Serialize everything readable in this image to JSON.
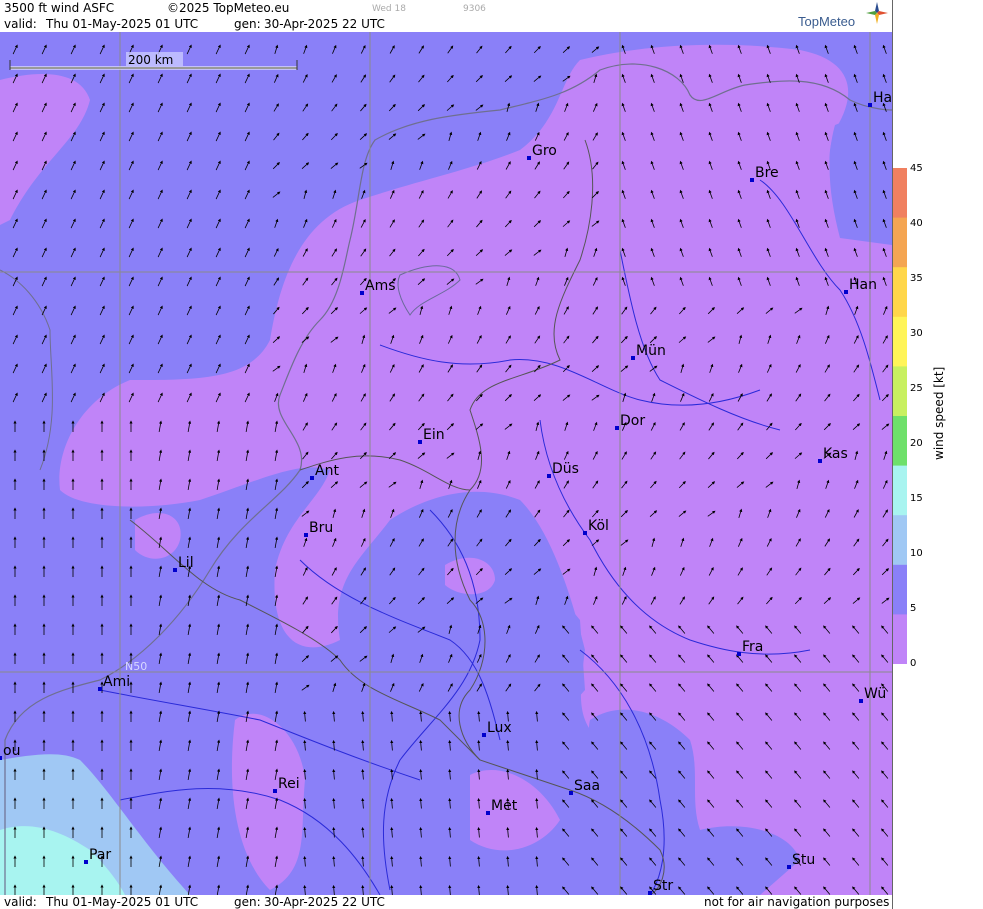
{
  "header": {
    "title": "3500 ft wind ASFC",
    "copyright": "©2025 TopMeteo.eu",
    "faint_day": "Wed 18",
    "faint_code": "9306",
    "valid_label": "valid:",
    "valid_value": "Thu   01-May-2025   01 UTC",
    "gen_label": "gen:",
    "gen_value": "30-Apr-2025 22 UTC",
    "logo": "TopMeteo"
  },
  "footer": {
    "valid_label": "valid:",
    "valid_value": "Thu   01-May-2025   01 UTC",
    "gen_label": "gen:",
    "gen_value": "30-Apr-2025 22 UTC",
    "disclaimer": "not for air navigation purposes"
  },
  "map": {
    "scale_label": "200 km",
    "lat_label": "N50",
    "cities": [
      "Ha",
      "Gro",
      "Bre",
      "Ams",
      "Han",
      "Mün",
      "Dor",
      "Ein",
      "Ant",
      "Düs",
      "Kas",
      "Köl",
      "Bru",
      "Lil",
      "Fra",
      "Ami",
      "Wü",
      "Lux",
      "ou",
      "Rei",
      "Saa",
      "Met",
      "Stu",
      "Par",
      "Str"
    ]
  },
  "legend": {
    "unit": "wind speed  [kt]",
    "ticks": [
      "45",
      "40",
      "35",
      "30",
      "25",
      "20",
      "15",
      "10",
      "5",
      "0"
    ],
    "colors": [
      "#f08060",
      "#f4a552",
      "#ffd64a",
      "#fff458",
      "#c8f060",
      "#6ee06a",
      "#a8f4f0",
      "#a0c8f4",
      "#8a80f8",
      "#c084f8"
    ]
  }
}
